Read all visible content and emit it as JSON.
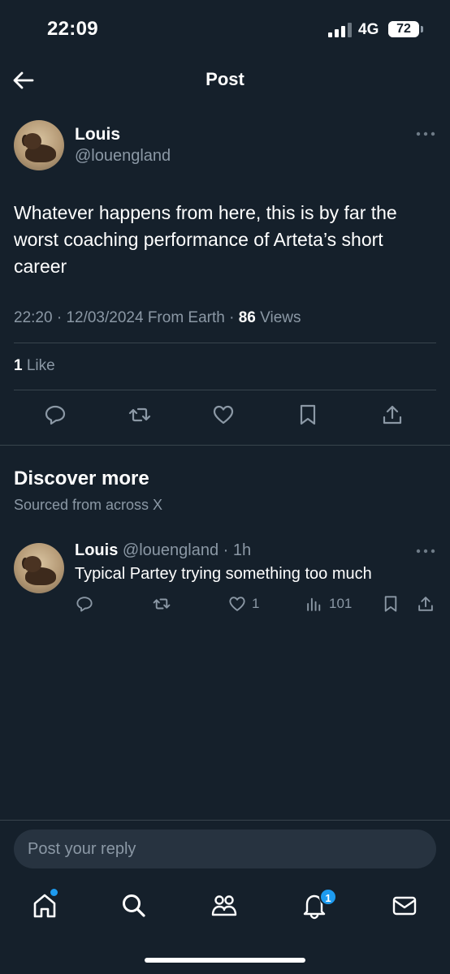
{
  "status_bar": {
    "time": "22:09",
    "network": "4G",
    "battery": "72",
    "battery_fraction": 0.72
  },
  "header": {
    "title": "Post"
  },
  "post": {
    "author_name": "Louis",
    "author_handle": "@louengland",
    "text": "Whatever happens from here, this is by far the worst coaching performance of Arteta’s short career",
    "time": "22:20",
    "date": "12/03/2024",
    "source": "From Earth",
    "views_count": "86",
    "views_label": "Views",
    "likes_count": "1",
    "likes_label": "Like",
    "actions": [
      "reply-icon",
      "retweet-icon",
      "heart-icon",
      "bookmark-icon",
      "share-icon"
    ]
  },
  "discover": {
    "title": "Discover more",
    "subtitle": "Sourced from across X",
    "related": {
      "author_name": "Louis",
      "author_handle": "@louengland",
      "age": "1h",
      "text": "Typical Partey trying something too much",
      "likes": "1",
      "views": "101"
    }
  },
  "reply": {
    "placeholder": "Post your reply"
  },
  "tab_bar": {
    "items": [
      "home-icon",
      "search-icon",
      "communities-icon",
      "notifications-icon",
      "messages-icon"
    ],
    "notification_count": "1"
  },
  "colors": {
    "background": "#15202b",
    "accent": "#1d9bf0",
    "muted": "#8b98a5",
    "divider": "#38444d"
  }
}
